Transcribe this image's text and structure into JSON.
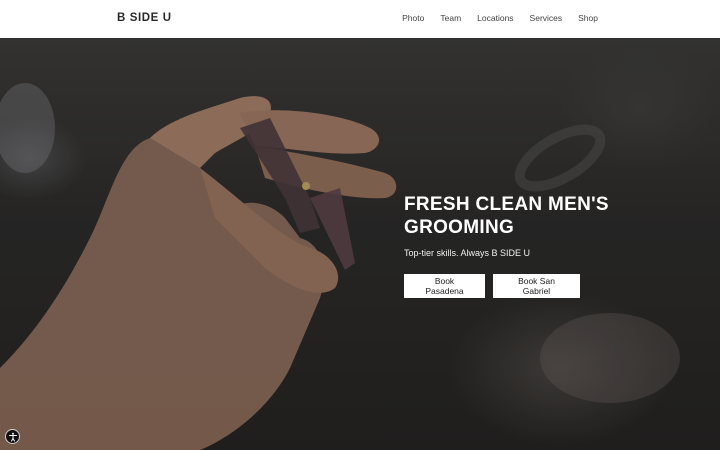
{
  "brand": {
    "logo": "B SIDE U"
  },
  "nav": [
    "Photo",
    "Team",
    "Locations",
    "Services",
    "Shop"
  ],
  "hero": {
    "title": "FRESH CLEAN MEN'S GROOMING",
    "subtitle": "Top-tier skills. Always B SIDE U",
    "buttons": [
      "Book Pasadena",
      "Book San Gabriel"
    ],
    "background_image": "hand-holding-scissors-photo"
  },
  "accessibility": {
    "icon": "accessibility-icon"
  },
  "colors": {
    "header_bg": "#ffffff",
    "text_dark": "#2a2a2a",
    "button_bg": "#ffffff",
    "hero_text": "#ffffff"
  }
}
